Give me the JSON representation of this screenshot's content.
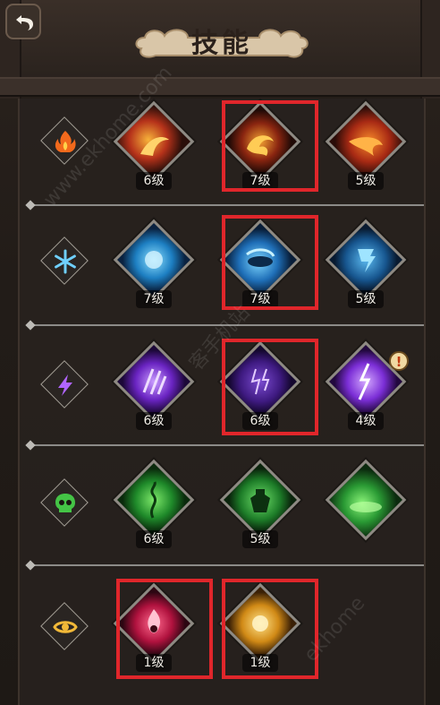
{
  "header": {
    "title": "技能"
  },
  "colors": {
    "highlight": "#e0262b",
    "fire": "#f2691c",
    "ice": "#4fb7f0",
    "lightning": "#a24ff0",
    "poison": "#3fbf3a",
    "light": "#f2b938"
  },
  "rows": [
    {
      "element_icon": "fire-icon",
      "skills": [
        {
          "icon": "fire-wave-skill-icon",
          "level": "6级"
        },
        {
          "icon": "fire-phoenix-skill-icon",
          "level": "7级"
        },
        {
          "icon": "fire-breath-skill-icon",
          "level": "5级"
        }
      ]
    },
    {
      "element_icon": "snowflake-icon",
      "skills": [
        {
          "icon": "ice-orb-skill-icon",
          "level": "7级"
        },
        {
          "icon": "ice-vortex-skill-icon",
          "level": "7级"
        },
        {
          "icon": "ice-tornado-skill-icon",
          "level": "5级"
        }
      ]
    },
    {
      "element_icon": "lightning-icon",
      "skills": [
        {
          "icon": "lightning-claw-skill-icon",
          "level": "6级"
        },
        {
          "icon": "lightning-storm-skill-icon",
          "level": "6级"
        },
        {
          "icon": "lightning-strike-skill-icon",
          "level": "4级",
          "alert": "!"
        }
      ]
    },
    {
      "element_icon": "skull-icon",
      "skills": [
        {
          "icon": "poison-vine-skill-icon",
          "level": "6级"
        },
        {
          "icon": "poison-ghoul-skill-icon",
          "level": "5级"
        },
        {
          "icon": "poison-cloud-skill-icon",
          "level": ""
        }
      ]
    },
    {
      "element_icon": "eye-icon",
      "skills": [
        {
          "icon": "holy-flame-skill-icon",
          "level": "1级"
        },
        {
          "icon": "holy-light-skill-icon",
          "level": "1级"
        }
      ]
    }
  ],
  "watermark": {
    "text1": "www.ekhome.com",
    "text2": "客手机站",
    "text3": "ekhome"
  }
}
